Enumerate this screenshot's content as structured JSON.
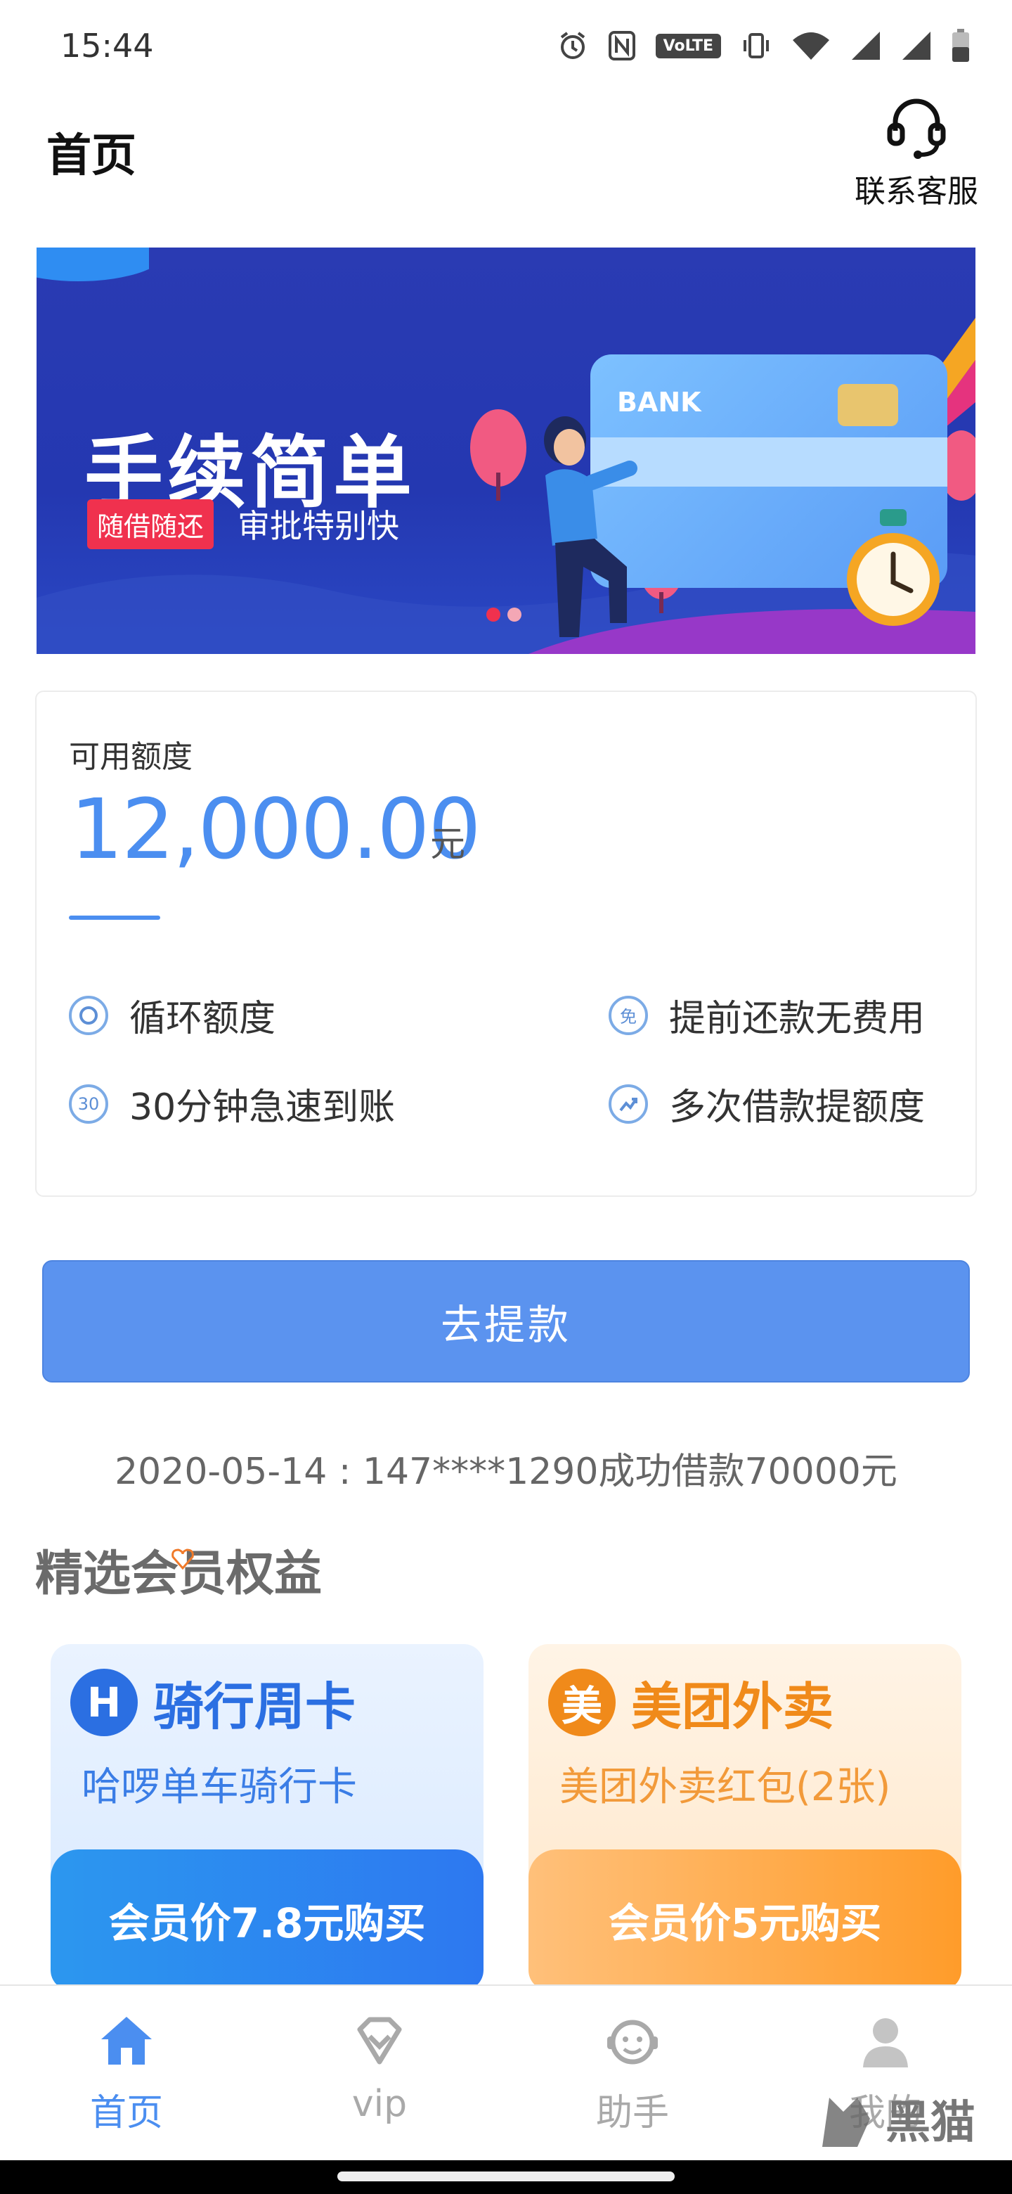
{
  "status_bar": {
    "time": "15:44",
    "icons": [
      "alarm-icon",
      "nfc-icon",
      "volte-icon",
      "vibrate-icon",
      "wifi-icon",
      "signal-icon",
      "signal-icon-2",
      "battery-icon"
    ],
    "volte_label": "VoLTE"
  },
  "header": {
    "title": "首页",
    "support_label": "联系客服"
  },
  "banner": {
    "headline": "手续简单",
    "tag": "随借随还",
    "subline": "审批特别快",
    "card_label": "BANK",
    "slides": 2,
    "active_slide": 1
  },
  "credit": {
    "label": "可用额度",
    "amount": "12,000.00",
    "unit": "元",
    "features": [
      {
        "icon": "circle-icon",
        "icon_text": "",
        "text": "循环额度"
      },
      {
        "icon": "free-icon",
        "icon_text": "免",
        "text": "提前还款无费用"
      },
      {
        "icon": "thirty-icon",
        "icon_text": "30",
        "text": "30分钟急速到账"
      },
      {
        "icon": "trend-icon",
        "icon_text": "",
        "text": "多次借款提额度"
      }
    ]
  },
  "cta": {
    "label": "去提款"
  },
  "ticker": {
    "text": "2020-05-14 : 147****1290成功借款70000元"
  },
  "benefits": {
    "title": "精选会员权益",
    "items": [
      {
        "logo": "H",
        "title": "骑行周卡",
        "subtitle": "哈啰单车骑行卡",
        "button": "会员价7.8元购买"
      },
      {
        "logo": "美",
        "title": "美团外卖",
        "subtitle": "美团外卖红包(2张)",
        "button": "会员价5元购买"
      }
    ]
  },
  "nav": {
    "items": [
      {
        "label": "首页",
        "icon": "home-icon",
        "active": true
      },
      {
        "label": "vip",
        "icon": "vip-heart-icon",
        "active": false
      },
      {
        "label": "助手",
        "icon": "assistant-icon",
        "active": false
      },
      {
        "label": "我的",
        "icon": "profile-icon",
        "active": false
      }
    ]
  },
  "watermark": {
    "text": "黑猫"
  },
  "colors": {
    "accent": "#4b8ef0",
    "button": "#5b93ef",
    "banner_bg": "#2a3bb3",
    "tag_red": "#f0314e",
    "orange": "#f08a1a"
  }
}
